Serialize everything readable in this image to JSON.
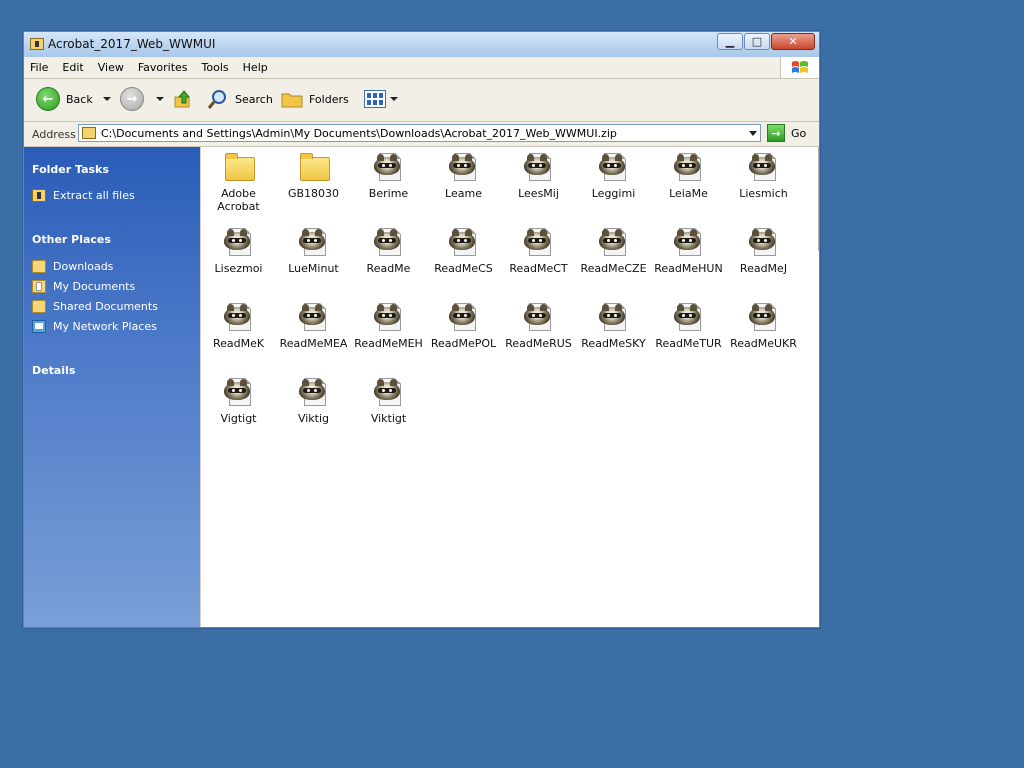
{
  "window": {
    "title": "Acrobat_2017_Web_WWMUI",
    "controls": [
      "minimize",
      "maximize",
      "close"
    ]
  },
  "menu": [
    "File",
    "Edit",
    "View",
    "Favorites",
    "Tools",
    "Help"
  ],
  "toolbar": {
    "back_label": "Back",
    "search_label": "Search",
    "folders_label": "Folders"
  },
  "address": {
    "label": "Address",
    "value": "C:\\Documents and Settings\\Admin\\My Documents\\Downloads\\Acrobat_2017_Web_WWMUI.zip",
    "go_label": "Go"
  },
  "tasks": {
    "folder_tasks_heading": "Folder Tasks",
    "folder_tasks": [
      {
        "label": "Extract all files",
        "icon": "zip-icon"
      }
    ],
    "other_places_heading": "Other Places",
    "other_places": [
      {
        "label": "Downloads",
        "icon": "folder-icon"
      },
      {
        "label": "My Documents",
        "icon": "documents-icon"
      },
      {
        "label": "Shared Documents",
        "icon": "folder-icon"
      },
      {
        "label": "My Network Places",
        "icon": "network-icon"
      }
    ],
    "details_heading": "Details"
  },
  "files": [
    {
      "name": "Adobe Acrobat",
      "type": "folder"
    },
    {
      "name": "GB18030",
      "type": "folder"
    },
    {
      "name": "Berime",
      "type": "document"
    },
    {
      "name": "Leame",
      "type": "document"
    },
    {
      "name": "LeesMij",
      "type": "document"
    },
    {
      "name": "Leggimi",
      "type": "document"
    },
    {
      "name": "LeiaMe",
      "type": "document"
    },
    {
      "name": "Liesmich",
      "type": "document"
    },
    {
      "name": "Lisezmoi",
      "type": "document"
    },
    {
      "name": "LueMinut",
      "type": "document"
    },
    {
      "name": "ReadMe",
      "type": "document"
    },
    {
      "name": "ReadMeCS",
      "type": "document"
    },
    {
      "name": "ReadMeCT",
      "type": "document"
    },
    {
      "name": "ReadMeCZE",
      "type": "document"
    },
    {
      "name": "ReadMeHUN",
      "type": "document"
    },
    {
      "name": "ReadMeJ",
      "type": "document"
    },
    {
      "name": "ReadMeK",
      "type": "document"
    },
    {
      "name": "ReadMeMEA",
      "type": "document"
    },
    {
      "name": "ReadMeMEH",
      "type": "document"
    },
    {
      "name": "ReadMePOL",
      "type": "document"
    },
    {
      "name": "ReadMeRUS",
      "type": "document"
    },
    {
      "name": "ReadMeSKY",
      "type": "document"
    },
    {
      "name": "ReadMeTUR",
      "type": "document"
    },
    {
      "name": "ReadMeUKR",
      "type": "document"
    },
    {
      "name": "Vigtigt",
      "type": "document"
    },
    {
      "name": "Viktig",
      "type": "document"
    },
    {
      "name": "Viktigt",
      "type": "document"
    }
  ],
  "colors": {
    "desktop": "#3a6ea5",
    "task_pane_top": "#2a5cb8",
    "task_pane_bottom": "#7a9fd6"
  }
}
